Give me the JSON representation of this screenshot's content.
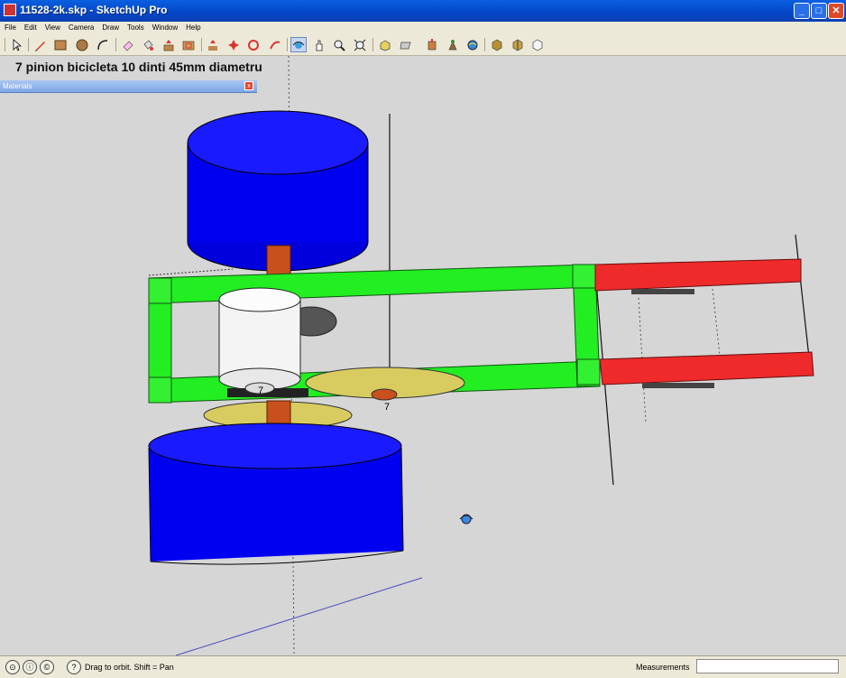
{
  "window": {
    "title": "11528-2k.skp - SketchUp Pro",
    "minimize": "_",
    "maximize": "□",
    "close": "✕"
  },
  "menu": [
    "File",
    "Edit",
    "View",
    "Camera",
    "Draw",
    "Tools",
    "Window",
    "Help"
  ],
  "toolbar": [
    "select-icon",
    "pencil-icon",
    "rectangle-icon",
    "circle-icon",
    "arc-icon",
    "eraser-icon",
    "paint-bucket-icon",
    "pushpull-icon",
    "move-icon",
    "rotate-icon",
    "offset-icon",
    "scale-icon",
    "orbit-icon",
    "pan-icon",
    "zoom-icon",
    "zoom-extents-icon",
    "iso-view-icon",
    "top-view-icon",
    "front-view-icon",
    "right-view-icon",
    "back-view-icon",
    "left-view-icon",
    "xray-icon",
    "wireframe-icon",
    "hidden-line-icon",
    "shaded-icon"
  ],
  "scene": {
    "title": "7 pinion bicicleta 10 dinti 45mm diametru",
    "label_7a": "7",
    "label_7b": "7"
  },
  "materials_panel": {
    "title": "Materials",
    "close": "x"
  },
  "status": {
    "hint": "Drag to orbit.  Shift = Pan",
    "measurements_label": "Measurements",
    "measurements_value": ""
  },
  "colors": {
    "blue": "#0000f0",
    "green": "#22ee22",
    "red": "#ee2a2a",
    "yellow": "#d8cc60",
    "white": "#f4f4f4",
    "orange": "#c8501c"
  }
}
